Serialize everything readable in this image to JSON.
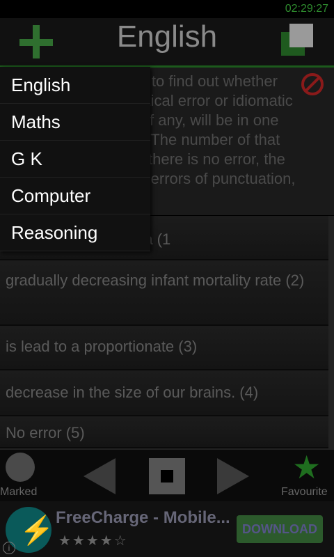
{
  "status": {
    "time": "02:29:27"
  },
  "header": {
    "title": "English"
  },
  "question": {
    "text": "Read each sentence to find out whether there is any grammatical error or idiomatic error in it. The error, if any, will be in one part of the sentence. The number of that part is the answer. If there is no error, the answer is (5) (ignore errors of punctuation, if any)."
  },
  "options": [
    "Experts believe that a (1",
    "gradually decreasing infant mortality rate (2)",
    "is lead to a proportionate (3)",
    "decrease in the size of our brains. (4)",
    "No error (5)"
  ],
  "bottombar": {
    "marked_label": "Marked",
    "favourite_label": "Favourite"
  },
  "ad": {
    "title": "FreeCharge - Mobile...",
    "stars": "★★★★☆",
    "button": "DOWNLOAD"
  },
  "menu": [
    "English",
    "Maths",
    "G K",
    "Computer",
    "Reasoning"
  ]
}
